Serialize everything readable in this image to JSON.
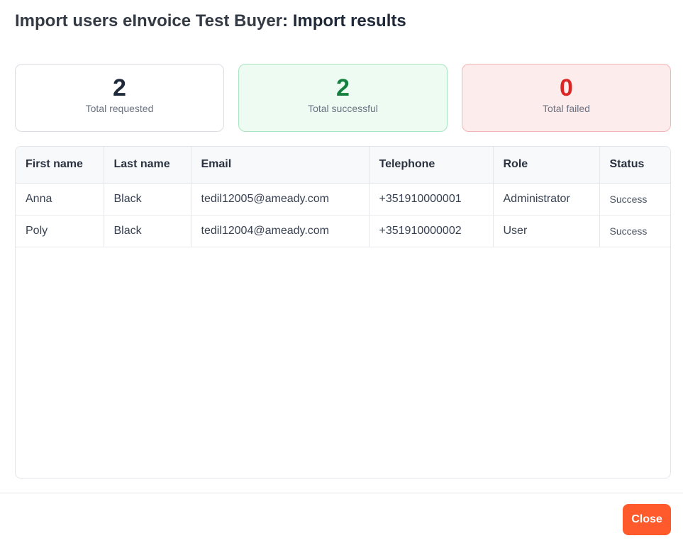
{
  "dialog": {
    "title_prefix": "Import users eInvoice Test Buyer",
    "title_separator": ":",
    "title_suffix": "Import results"
  },
  "summary": {
    "requested": {
      "value": "2",
      "label": "Total requested"
    },
    "successful": {
      "value": "2",
      "label": "Total successful"
    },
    "failed": {
      "value": "0",
      "label": "Total failed"
    }
  },
  "colors": {
    "success": "#15803d",
    "failed": "#dc2626",
    "accent": "#ff5a2c"
  },
  "table": {
    "columns": [
      "First name",
      "Last name",
      "Email",
      "Telephone",
      "Role",
      "Status"
    ],
    "rows": [
      [
        "Anna",
        "Black",
        "tedil12005@ameady.com",
        "+351910000001",
        "Administrator",
        "Success"
      ],
      [
        "Poly",
        "Black",
        "tedil12004@ameady.com",
        "+351910000002",
        "User",
        "Success"
      ]
    ]
  },
  "footer": {
    "close_label": "Close"
  }
}
